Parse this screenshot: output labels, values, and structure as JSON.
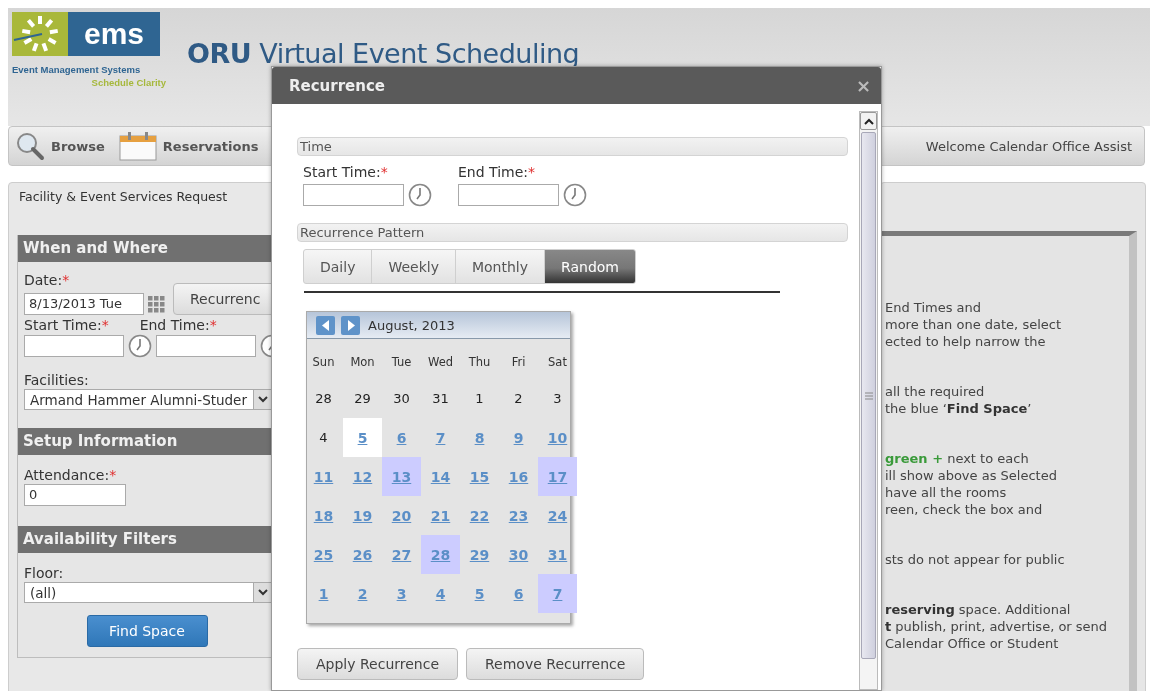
{
  "header": {
    "logo": {
      "word": "ems",
      "tagline": "Event Management Systems",
      "slogan": "Schedule Clarity"
    },
    "title_bold": "ORU",
    "title": "Virtual Event Scheduling"
  },
  "nav": {
    "items": [
      {
        "label": "Browse",
        "kind": "search"
      },
      {
        "label": "Reservations",
        "kind": "calendar"
      }
    ],
    "welcome": "Welcome Calendar Office Assist"
  },
  "form": {
    "title": "Facility & Event Services Request",
    "when_where": {
      "heading": "When and Where",
      "date": {
        "label": "Date:",
        "mark": "*",
        "value": "8/13/2013 Tue"
      },
      "recurrence_button": "Recurrenc",
      "start_time": {
        "label": "Start Time:",
        "mark": "*"
      },
      "end_time": {
        "label": "End Time:",
        "mark": "*"
      },
      "facilities": {
        "label": "Facilities:",
        "value": "Armand Hammer Alumni-Studer"
      }
    },
    "setup": {
      "heading": "Setup Information",
      "attendance": {
        "label": "Attendance:",
        "mark": "*",
        "value": "0"
      }
    },
    "filters": {
      "heading": "Availability Filters",
      "floor": {
        "label": "Floor:",
        "value": "(all)"
      },
      "find_button": "Find Space"
    }
  },
  "help": {
    "paragraphs": [
      [
        {
          "text": "End Times and"
        },
        {
          "text": "more than one date, select"
        },
        {
          "text": "ected to help narrow the"
        }
      ],
      [
        {
          "text": "all the required"
        },
        {
          "text": "the blue ‘**Find Space**’"
        }
      ],
      [
        {
          "lead": "green +",
          "text": " next to each"
        },
        {
          "text": "ill show above as Selected"
        },
        {
          "text": "have all the rooms"
        },
        {
          "text": "reen, check the box and"
        }
      ],
      [
        {
          "text": "sts do not appear for public"
        }
      ],
      [
        {
          "text": "**reserving** space.  Additional"
        },
        {
          "text": "**t** publish, print, advertise, or send"
        },
        {
          "text": "Calendar Office or Student"
        }
      ]
    ]
  },
  "dialog": {
    "title": "Recurrence",
    "close": "×",
    "time": {
      "legend": "Time",
      "start": {
        "label": "Start Time:",
        "mark": "*"
      },
      "end": {
        "label": "End Time:",
        "mark": "*"
      }
    },
    "pattern": {
      "legend": "Recurrence Pattern",
      "tabs": [
        {
          "label": "Daily",
          "selected": false
        },
        {
          "label": "Weekly",
          "selected": false
        },
        {
          "label": "Monthly",
          "selected": false
        },
        {
          "label": "Random",
          "selected": true
        }
      ]
    },
    "calendar": {
      "month": "August, 2013",
      "weekdays": [
        "Sun",
        "Mon",
        "Tue",
        "Wed",
        "Thu",
        "Fri",
        "Sat"
      ],
      "weeks": [
        [
          {
            "day": "28",
            "link": false,
            "selected": false,
            "current": false
          },
          {
            "day": "29",
            "link": false,
            "selected": false,
            "current": false
          },
          {
            "day": "30",
            "link": false,
            "selected": false,
            "current": false
          },
          {
            "day": "31",
            "link": false,
            "selected": false,
            "current": false
          },
          {
            "day": "1",
            "link": false,
            "selected": false,
            "current": false
          },
          {
            "day": "2",
            "link": false,
            "selected": false,
            "current": false
          },
          {
            "day": "3",
            "link": false,
            "selected": false,
            "current": false
          }
        ],
        [
          {
            "day": "4",
            "link": false,
            "selected": false,
            "current": false
          },
          {
            "day": "5",
            "link": true,
            "selected": false,
            "current": true
          },
          {
            "day": "6",
            "link": true,
            "selected": false,
            "current": false
          },
          {
            "day": "7",
            "link": true,
            "selected": false,
            "current": false
          },
          {
            "day": "8",
            "link": true,
            "selected": false,
            "current": false
          },
          {
            "day": "9",
            "link": true,
            "selected": false,
            "current": false
          },
          {
            "day": "10",
            "link": true,
            "selected": false,
            "current": false
          }
        ],
        [
          {
            "day": "11",
            "link": true,
            "selected": false,
            "current": false
          },
          {
            "day": "12",
            "link": true,
            "selected": false,
            "current": false
          },
          {
            "day": "13",
            "link": true,
            "selected": true,
            "current": false
          },
          {
            "day": "14",
            "link": true,
            "selected": false,
            "current": false
          },
          {
            "day": "15",
            "link": true,
            "selected": false,
            "current": false
          },
          {
            "day": "16",
            "link": true,
            "selected": false,
            "current": false
          },
          {
            "day": "17",
            "link": true,
            "selected": true,
            "current": false
          }
        ],
        [
          {
            "day": "18",
            "link": true,
            "selected": false,
            "current": false
          },
          {
            "day": "19",
            "link": true,
            "selected": false,
            "current": false
          },
          {
            "day": "20",
            "link": true,
            "selected": false,
            "current": false
          },
          {
            "day": "21",
            "link": true,
            "selected": false,
            "current": false
          },
          {
            "day": "22",
            "link": true,
            "selected": false,
            "current": false
          },
          {
            "day": "23",
            "link": true,
            "selected": false,
            "current": false
          },
          {
            "day": "24",
            "link": true,
            "selected": false,
            "current": false
          }
        ],
        [
          {
            "day": "25",
            "link": true,
            "selected": false,
            "current": false
          },
          {
            "day": "26",
            "link": true,
            "selected": false,
            "current": false
          },
          {
            "day": "27",
            "link": true,
            "selected": false,
            "current": false
          },
          {
            "day": "28",
            "link": true,
            "selected": true,
            "current": false
          },
          {
            "day": "29",
            "link": true,
            "selected": false,
            "current": false
          },
          {
            "day": "30",
            "link": true,
            "selected": false,
            "current": false
          },
          {
            "day": "31",
            "link": true,
            "selected": false,
            "current": false
          }
        ],
        [
          {
            "day": "1",
            "link": true,
            "selected": false,
            "current": false
          },
          {
            "day": "2",
            "link": true,
            "selected": false,
            "current": false
          },
          {
            "day": "3",
            "link": true,
            "selected": false,
            "current": false
          },
          {
            "day": "4",
            "link": true,
            "selected": false,
            "current": false
          },
          {
            "day": "5",
            "link": true,
            "selected": false,
            "current": false
          },
          {
            "day": "6",
            "link": true,
            "selected": false,
            "current": false
          },
          {
            "day": "7",
            "link": true,
            "selected": true,
            "current": false
          }
        ]
      ]
    },
    "buttons": [
      "Apply Recurrence",
      "Remove Recurrence"
    ]
  }
}
